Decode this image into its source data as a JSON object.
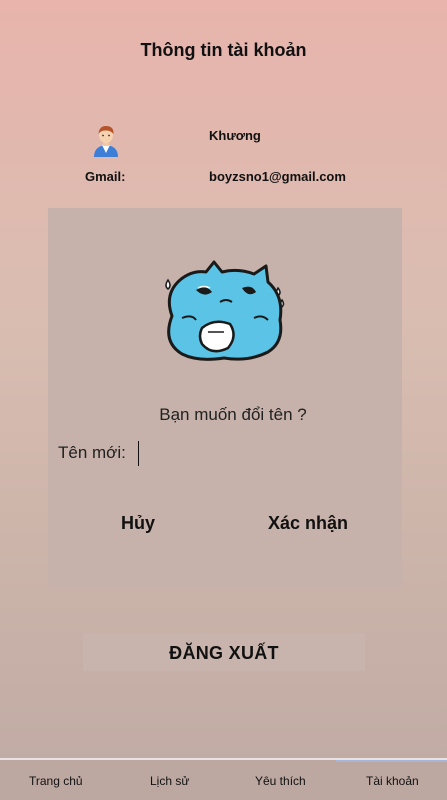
{
  "header": {
    "title": "Thông tin tài khoản"
  },
  "profile": {
    "name_value": "Khương",
    "gmail_label": "Gmail:",
    "gmail_value": "boyzsno1@gmail.com"
  },
  "rename_dialog": {
    "question": "Bạn muốn đổi tên ?",
    "new_name_label": "Tên mới:",
    "new_name_value": "",
    "cancel_label": "Hủy",
    "confirm_label": "Xác nhận"
  },
  "logout_label": "ĐĂNG XUẤT",
  "bottom_nav": {
    "items": [
      {
        "label": "Trang chủ"
      },
      {
        "label": "Lịch sử"
      },
      {
        "label": "Yêu thích"
      },
      {
        "label": "Tài khoản"
      }
    ],
    "active_index": 3
  },
  "colors": {
    "accent_active": "#a7b5d8",
    "mascot": "#5bc4e6"
  },
  "icons": {
    "avatar": "user-avatar-icon",
    "mascot": "blue-cat-mascot"
  }
}
